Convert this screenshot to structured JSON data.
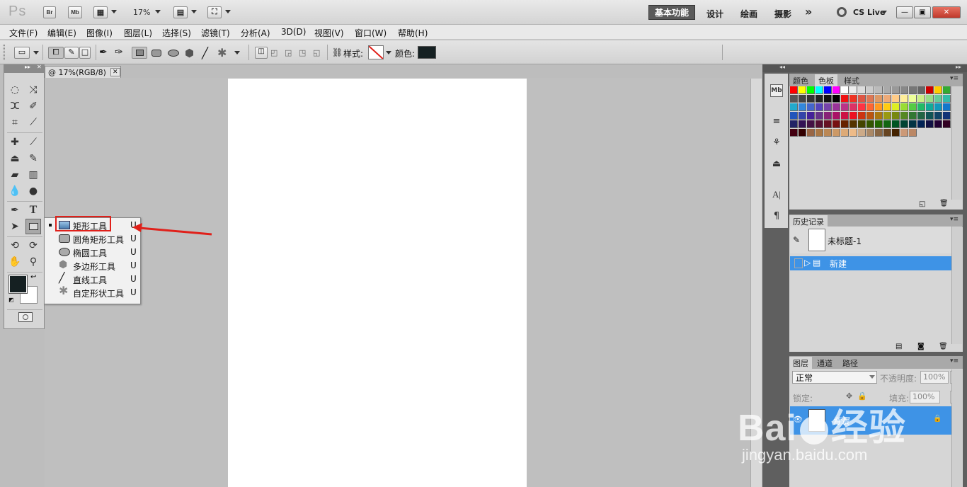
{
  "titlebar": {
    "logo": "Ps",
    "br": "Br",
    "mb": "Mb",
    "zoom": "17%",
    "workspaces": [
      "基本功能",
      "设计",
      "绘画",
      "摄影"
    ],
    "more": "»",
    "cslive": "CS Live",
    "win_min": "—",
    "win_max": "▣",
    "win_close": "✕"
  },
  "menubar": [
    "文件(F)",
    "编辑(E)",
    "图像(I)",
    "图层(L)",
    "选择(S)",
    "滤镜(T)",
    "分析(A)",
    "3D(D)",
    "视图(V)",
    "窗口(W)",
    "帮助(H)"
  ],
  "options": {
    "style_label": "样式:",
    "color_label": "颜色:",
    "color_value": "#152022"
  },
  "document": {
    "tab_title": "@ 17%(RGB/8)",
    "tab_close": "✕"
  },
  "flyout": {
    "items": [
      {
        "label": "矩形工具",
        "shortcut": "U",
        "icon": "rectangle-icon"
      },
      {
        "label": "圆角矩形工具",
        "shortcut": "U",
        "icon": "rounded-rectangle-icon"
      },
      {
        "label": "椭圆工具",
        "shortcut": "U",
        "icon": "ellipse-icon"
      },
      {
        "label": "多边形工具",
        "shortcut": "U",
        "icon": "polygon-icon"
      },
      {
        "label": "直线工具",
        "shortcut": "U",
        "icon": "line-icon"
      },
      {
        "label": "自定形状工具",
        "shortcut": "U",
        "icon": "custom-shape-icon"
      }
    ]
  },
  "panels": {
    "swatches": {
      "tabs": [
        "颜色",
        "色板",
        "样式"
      ],
      "colors": [
        "#ff0000",
        "#ffff00",
        "#00ff00",
        "#00ffff",
        "#0000ff",
        "#ff00ff",
        "#ffffff",
        "#eeeeee",
        "#dddddd",
        "#cccccc",
        "#bbbbbb",
        "#aaaaaa",
        "#999999",
        "#888888",
        "#777777",
        "#666666",
        "#cc0000",
        "#ffcc00",
        "#33aa33",
        "#555555",
        "#444444",
        "#333333",
        "#222222",
        "#111111",
        "#000000",
        "#ee1111",
        "#ee3322",
        "#dd5544",
        "#dd7755",
        "#dd9966",
        "#eeaa77",
        "#ffcc88",
        "#ffee99",
        "#eeff99",
        "#ccee88",
        "#99dd88",
        "#66cc99",
        "#33bbaa",
        "#22aacc",
        "#3388dd",
        "#4466cc",
        "#5544bb",
        "#7744aa",
        "#993399",
        "#bb3388",
        "#dd3366",
        "#ff3344",
        "#ff6633",
        "#ff9922",
        "#ffcc11",
        "#ddee22",
        "#99dd33",
        "#55cc44",
        "#22bb66",
        "#11aa99",
        "#1199bb",
        "#1177cc",
        "#2255bb",
        "#3344aa",
        "#442299",
        "#663388",
        "#882277",
        "#aa1166",
        "#cc1144",
        "#ee1122",
        "#cc3311",
        "#bb5511",
        "#aa7711",
        "#999911",
        "#778811",
        "#558822",
        "#337733",
        "#226644",
        "#115555",
        "#114466",
        "#113377",
        "#222266",
        "#331155",
        "#441144",
        "#551133",
        "#661122",
        "#771111",
        "#662200",
        "#553300",
        "#444400",
        "#335500",
        "#226600",
        "#116611",
        "#005522",
        "#004433",
        "#003344",
        "#002255",
        "#111144",
        "#220033",
        "#330022",
        "#440011",
        "#330000",
        "#996644",
        "#aa7744",
        "#bb8855",
        "#cc9966",
        "#ddaa77",
        "#eebb88",
        "#ccaa88",
        "#aa8866",
        "#886644",
        "#664422",
        "#442200",
        "#cc9977",
        "#bb8866"
      ]
    },
    "history": {
      "tab": "历史记录",
      "items": [
        "未标题-1",
        "新建"
      ]
    },
    "layers": {
      "tabs": [
        "图层",
        "通道",
        "路径"
      ],
      "blend_mode": "正常",
      "opacity_label": "不透明度:",
      "opacity_value": "100%",
      "lock_label": "锁定:",
      "fill_label": "填充:",
      "fill_value": "100%",
      "layer_name": "背景"
    }
  },
  "watermark": {
    "logo": "Bai",
    "logo2": "经验",
    "url": "jingyan.baidu.com"
  }
}
